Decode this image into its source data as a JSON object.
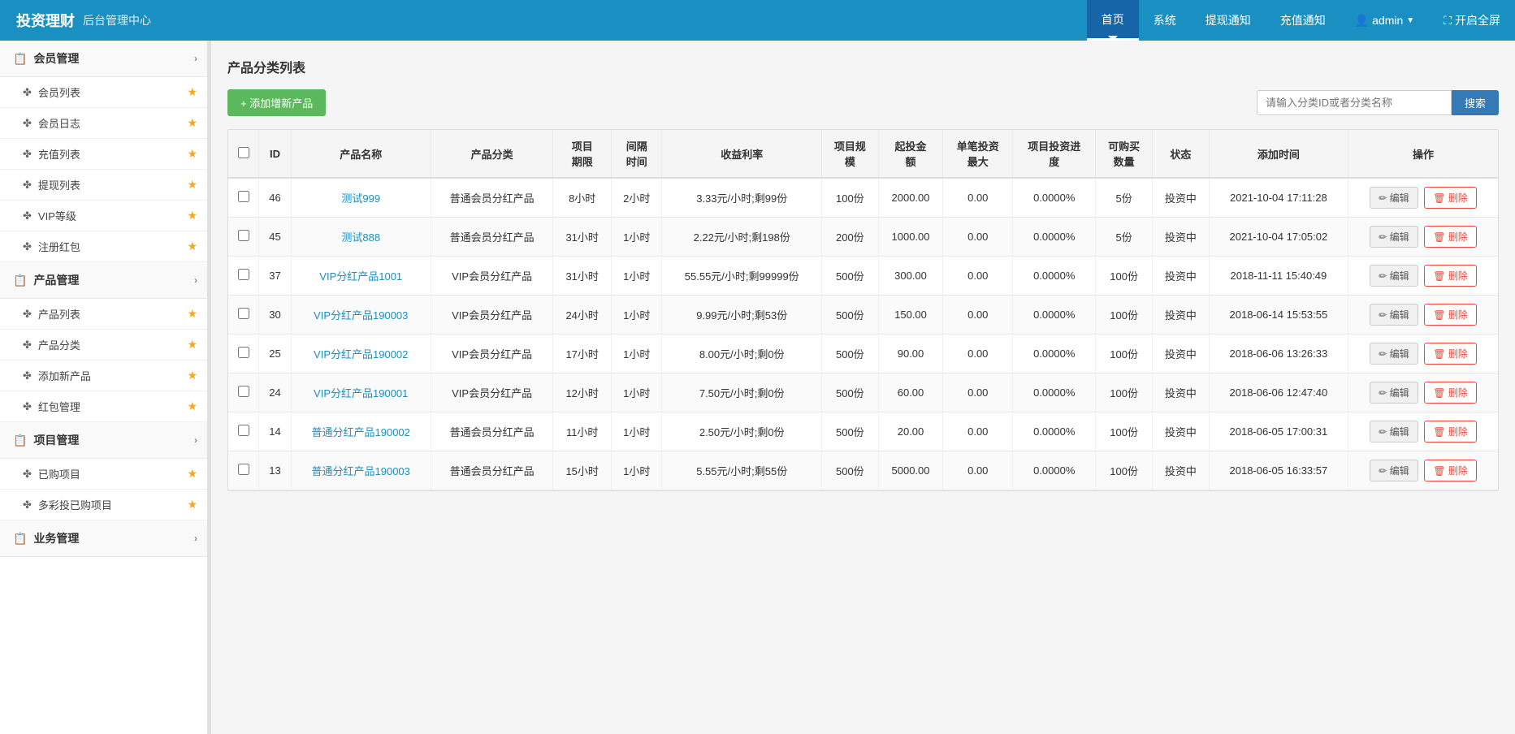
{
  "brand": {
    "logo": "投资理财",
    "subtitle": "后台管理中心"
  },
  "topnav": {
    "items": [
      {
        "label": "首页",
        "active": true
      },
      {
        "label": "系统",
        "active": false
      },
      {
        "label": "提现通知",
        "active": false
      },
      {
        "label": "充值通知",
        "active": false
      },
      {
        "label": "admin",
        "active": false,
        "caret": true,
        "icon": "user"
      },
      {
        "label": "开启全屏",
        "active": false,
        "icon": "fullscreen"
      }
    ]
  },
  "sidebar": {
    "sections": [
      {
        "label": "会员管理",
        "icon": "📋",
        "items": [
          {
            "label": "会员列表",
            "star": true
          },
          {
            "label": "会员日志",
            "star": true
          },
          {
            "label": "充值列表",
            "star": true
          },
          {
            "label": "提现列表",
            "star": true
          },
          {
            "label": "VIP等级",
            "star": true
          },
          {
            "label": "注册红包",
            "star": true
          }
        ]
      },
      {
        "label": "产品管理",
        "icon": "📋",
        "items": [
          {
            "label": "产品列表",
            "star": true
          },
          {
            "label": "产品分类",
            "star": true
          },
          {
            "label": "添加新产品",
            "star": true
          },
          {
            "label": "红包管理",
            "star": true
          }
        ]
      },
      {
        "label": "项目管理",
        "icon": "📋",
        "items": [
          {
            "label": "已购项目",
            "star": true
          },
          {
            "label": "多彩投已购项目",
            "star": true
          }
        ]
      },
      {
        "label": "业务管理",
        "icon": "📋",
        "items": []
      }
    ]
  },
  "page": {
    "title": "产品分类列表",
    "add_button": "+ 添加增新产品",
    "search_placeholder": "请输入分类ID或者分类名称",
    "search_button": "搜索"
  },
  "table": {
    "headers": [
      "",
      "ID",
      "产品名称",
      "产品分类",
      "项目期限",
      "间隔时间",
      "收益利率",
      "项目规模",
      "起投金额",
      "单笔投资最大",
      "项目投资进度",
      "可购买数量",
      "状态",
      "添加时间",
      "操作"
    ],
    "rows": [
      {
        "id": 46,
        "name": "测试999",
        "category": "普通会员分红产品",
        "period": "8小时",
        "interval": "2小时",
        "rate": "3.33元/小时;剩99份",
        "scale": "100份",
        "min_invest": "2000.00",
        "max_invest": "0.00",
        "progress": "0.0000%",
        "buyable": "5份",
        "status": "投资中",
        "add_time": "2021-10-04 17:11:28",
        "alt": false
      },
      {
        "id": 45,
        "name": "测试888",
        "category": "普通会员分红产品",
        "period": "31小时",
        "interval": "1小时",
        "rate": "2.22元/小时;剩198份",
        "scale": "200份",
        "min_invest": "1000.00",
        "max_invest": "0.00",
        "progress": "0.0000%",
        "buyable": "5份",
        "status": "投资中",
        "add_time": "2021-10-04 17:05:02",
        "alt": true
      },
      {
        "id": 37,
        "name": "VIP分红产品1001",
        "category": "VIP会员分红产品",
        "period": "31小时",
        "interval": "1小时",
        "rate": "55.55元/小时;剩99999份",
        "scale": "500份",
        "min_invest": "300.00",
        "max_invest": "0.00",
        "progress": "0.0000%",
        "buyable": "100份",
        "status": "投资中",
        "add_time": "2018-11-11 15:40:49",
        "alt": false
      },
      {
        "id": 30,
        "name": "VIP分红产品190003",
        "category": "VIP会员分红产品",
        "period": "24小时",
        "interval": "1小时",
        "rate": "9.99元/小时;剩53份",
        "scale": "500份",
        "min_invest": "150.00",
        "max_invest": "0.00",
        "progress": "0.0000%",
        "buyable": "100份",
        "status": "投资中",
        "add_time": "2018-06-14 15:53:55",
        "alt": true
      },
      {
        "id": 25,
        "name": "VIP分红产品190002",
        "category": "VIP会员分红产品",
        "period": "17小时",
        "interval": "1小时",
        "rate": "8.00元/小时;剩0份",
        "scale": "500份",
        "min_invest": "90.00",
        "max_invest": "0.00",
        "progress": "0.0000%",
        "buyable": "100份",
        "status": "投资中",
        "add_time": "2018-06-06 13:26:33",
        "alt": false
      },
      {
        "id": 24,
        "name": "VIP分红产品190001",
        "category": "VIP会员分红产品",
        "period": "12小时",
        "interval": "1小时",
        "rate": "7.50元/小时;剩0份",
        "scale": "500份",
        "min_invest": "60.00",
        "max_invest": "0.00",
        "progress": "0.0000%",
        "buyable": "100份",
        "status": "投资中",
        "add_time": "2018-06-06 12:47:40",
        "alt": true
      },
      {
        "id": 14,
        "name": "普通分红产品190002",
        "category": "普通会员分红产品",
        "period": "11小时",
        "interval": "1小时",
        "rate": "2.50元/小时;剩0份",
        "scale": "500份",
        "min_invest": "20.00",
        "max_invest": "0.00",
        "progress": "0.0000%",
        "buyable": "100份",
        "status": "投资中",
        "add_time": "2018-06-05 17:00:31",
        "alt": false
      },
      {
        "id": 13,
        "name": "普通分红产品190003",
        "category": "普通会员分红产品",
        "period": "15小时",
        "interval": "1小时",
        "rate": "5.55元/小时;剩55份",
        "scale": "500份",
        "min_invest": "5000.00",
        "max_invest": "0.00",
        "progress": "0.0000%",
        "buyable": "100份",
        "status": "投资中",
        "add_time": "2018-06-05 16:33:57",
        "alt": true
      }
    ],
    "edit_label": "✏ 编辑",
    "delete_label": "🗑 删除"
  }
}
